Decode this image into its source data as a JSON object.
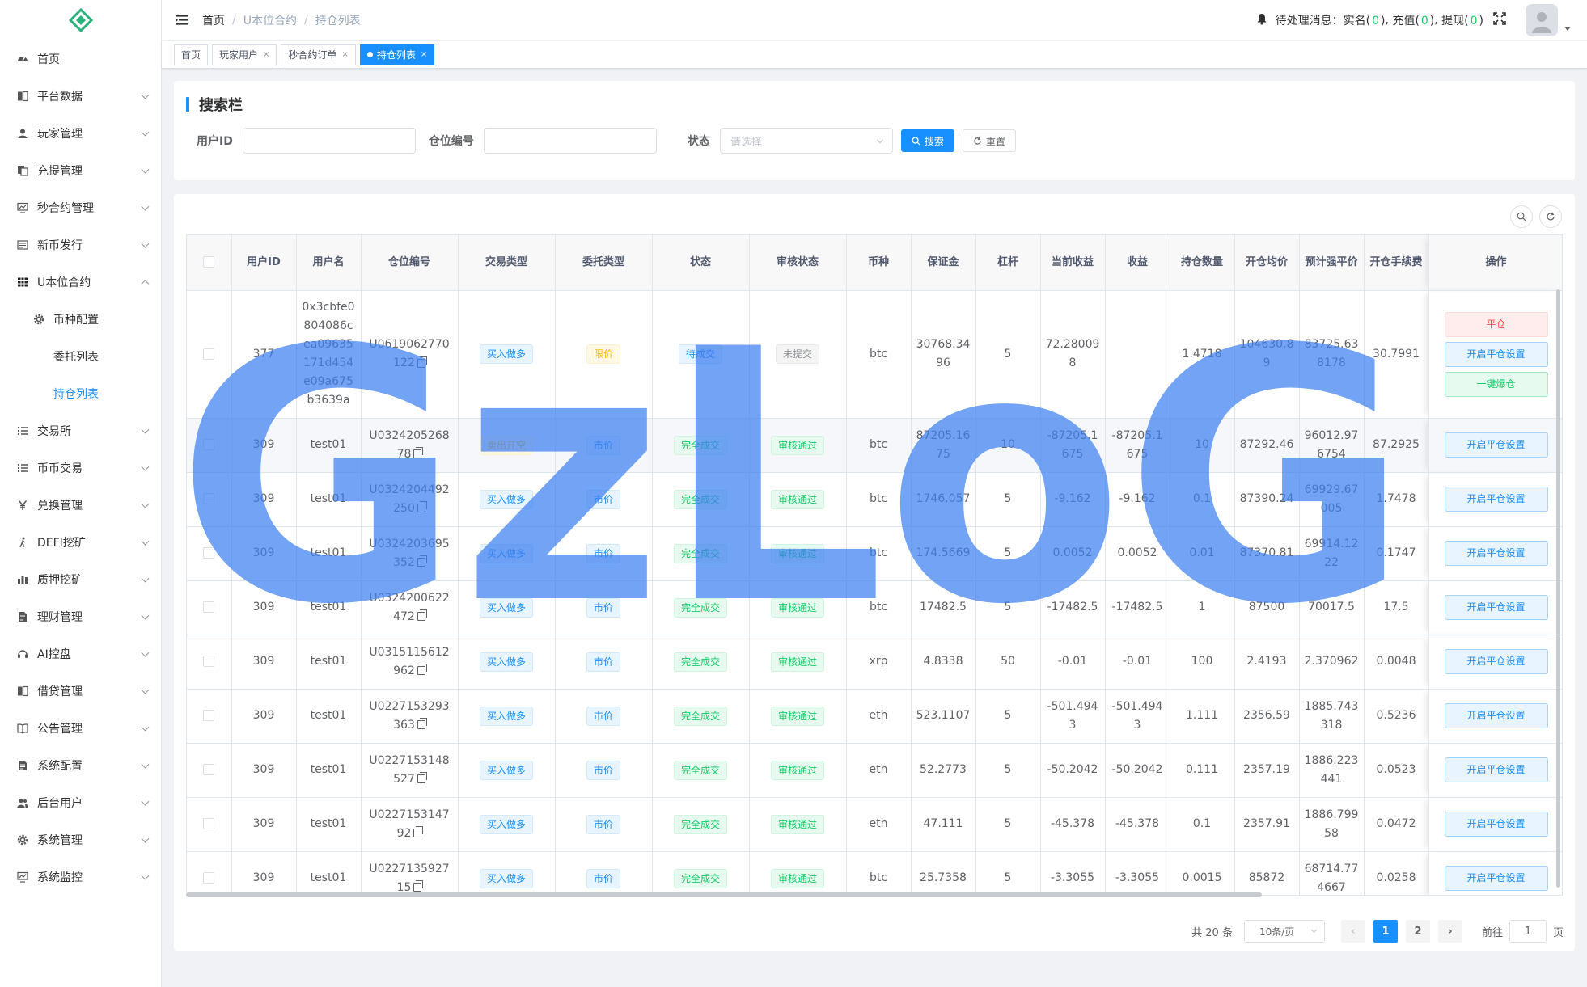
{
  "sidebar": {
    "items": [
      {
        "label": "首页",
        "icon": "dashboard-icon",
        "has_arrow": false
      },
      {
        "label": "平台数据",
        "icon": "book-icon",
        "has_arrow": true
      },
      {
        "label": "玩家管理",
        "icon": "user-icon",
        "has_arrow": true
      },
      {
        "label": "充提管理",
        "icon": "documents-icon",
        "has_arrow": true
      },
      {
        "label": "秒合约管理",
        "icon": "monitor-chart-icon",
        "has_arrow": true
      },
      {
        "label": "新币发行",
        "icon": "form-icon",
        "has_arrow": true
      },
      {
        "label": "U本位合约",
        "icon": "table-grid-icon",
        "has_arrow": true,
        "expanded": true
      },
      {
        "label": "币种配置",
        "icon": "gear-icon",
        "sub": true
      },
      {
        "label": "委托列表",
        "sub2": true
      },
      {
        "label": "持仓列表",
        "sub2": true,
        "active": true
      },
      {
        "label": "交易所",
        "icon": "list-icon",
        "has_arrow": true
      },
      {
        "label": "币币交易",
        "icon": "list-icon",
        "has_arrow": true
      },
      {
        "label": "兑换管理",
        "icon": "yen-icon",
        "has_arrow": true
      },
      {
        "label": "DEFI挖矿",
        "icon": "walk-icon",
        "has_arrow": true
      },
      {
        "label": "质押挖矿",
        "icon": "bar-chart-icon",
        "has_arrow": true
      },
      {
        "label": "理财管理",
        "icon": "note-icon",
        "has_arrow": true
      },
      {
        "label": "AI控盘",
        "icon": "headset-icon",
        "has_arrow": true
      },
      {
        "label": "借贷管理",
        "icon": "book-icon",
        "has_arrow": true
      },
      {
        "label": "公告管理",
        "icon": "open-book-icon",
        "has_arrow": true
      },
      {
        "label": "系统配置",
        "icon": "note-icon",
        "has_arrow": true
      },
      {
        "label": "后台用户",
        "icon": "users-icon",
        "has_arrow": true
      },
      {
        "label": "系统管理",
        "icon": "gear-icon",
        "has_arrow": true
      },
      {
        "label": "系统监控",
        "icon": "monitor-chart-icon",
        "has_arrow": true
      }
    ]
  },
  "header": {
    "breadcrumb": [
      "首页",
      "U本位合约",
      "持仓列表"
    ],
    "notice_prefix": "待处理消息：",
    "notice_items": [
      {
        "label": "实名",
        "count": "0"
      },
      {
        "label": "充值",
        "count": "0"
      },
      {
        "label": "提现",
        "count": "0"
      }
    ]
  },
  "tags": [
    {
      "label": "首页",
      "closable": false,
      "active": false
    },
    {
      "label": "玩家用户",
      "closable": true,
      "active": false
    },
    {
      "label": "秒合约订单",
      "closable": true,
      "active": false
    },
    {
      "label": "持仓列表",
      "closable": true,
      "active": true
    }
  ],
  "search": {
    "title": "搜索栏",
    "user_id_label": "用户ID",
    "position_no_label": "仓位编号",
    "status_label": "状态",
    "status_placeholder": "请选择",
    "search_btn": "搜索",
    "reset_btn": "重置"
  },
  "table": {
    "columns": [
      "用户ID",
      "用户名",
      "仓位编号",
      "交易类型",
      "委托类型",
      "状态",
      "审核状态",
      "币种",
      "保证金",
      "杠杆",
      "当前收益",
      "收益",
      "持仓数量",
      "开仓均价",
      "预计强平价",
      "开仓手续费",
      "操作"
    ],
    "rows": [
      {
        "user_id": "377",
        "username": "0x3cbfe0804086cea09635171d454e09a675b3639a",
        "position_no": "U0619062770122",
        "trade_type": "买入做多",
        "trade_color": "blue",
        "order_type": "限价",
        "order_color": "yellow",
        "status": "待成交",
        "status_color": "blue",
        "audit": "未提交",
        "audit_color": "gray",
        "coin": "btc",
        "margin": "30768.3496",
        "leverage": "5",
        "current_profit": "72.280098",
        "profit": "",
        "qty": "1.4718",
        "open_price": "104630.89",
        "liq_price": "83725.638178",
        "open_fee": "30.7991",
        "actions": [
          "平仓",
          "开启平仓设置",
          "一键爆仓"
        ],
        "tall": true
      },
      {
        "user_id": "309",
        "username": "test01",
        "position_no": "U032420526878",
        "trade_type": "卖出开空",
        "trade_color": "yellow",
        "order_type": "市价",
        "order_color": "blue",
        "status": "完全成交",
        "status_color": "green",
        "audit": "审核通过",
        "audit_color": "green",
        "coin": "btc",
        "margin": "87205.1675",
        "leverage": "10",
        "current_profit": "-87205.1675",
        "profit": "-87205.1675",
        "qty": "10",
        "open_price": "87292.46",
        "liq_price": "96012.976754",
        "open_fee": "87.2925",
        "actions": [
          "开启平仓设置"
        ],
        "hl": true
      },
      {
        "user_id": "309",
        "username": "test01",
        "position_no": "U0324204492250",
        "trade_type": "买入做多",
        "trade_color": "blue",
        "order_type": "市价",
        "order_color": "blue",
        "status": "完全成交",
        "status_color": "green",
        "audit": "审核通过",
        "audit_color": "green",
        "coin": "btc",
        "margin": "1746.057",
        "leverage": "5",
        "current_profit": "-9.162",
        "profit": "-9.162",
        "qty": "0.1",
        "open_price": "87390.24",
        "liq_price": "69929.67005",
        "open_fee": "1.7478",
        "actions": [
          "开启平仓设置"
        ]
      },
      {
        "user_id": "309",
        "username": "test01",
        "position_no": "U0324203695352",
        "trade_type": "买入做多",
        "trade_color": "blue",
        "order_type": "市价",
        "order_color": "blue",
        "status": "完全成交",
        "status_color": "green",
        "audit": "审核通过",
        "audit_color": "green",
        "coin": "btc",
        "margin": "174.5669",
        "leverage": "5",
        "current_profit": "0.0052",
        "profit": "0.0052",
        "qty": "0.01",
        "open_price": "87370.81",
        "liq_price": "69914.1222",
        "open_fee": "0.1747",
        "actions": [
          "开启平仓设置"
        ]
      },
      {
        "user_id": "309",
        "username": "test01",
        "position_no": "U0324200622472",
        "trade_type": "买入做多",
        "trade_color": "blue",
        "order_type": "市价",
        "order_color": "blue",
        "status": "完全成交",
        "status_color": "green",
        "audit": "审核通过",
        "audit_color": "green",
        "coin": "btc",
        "margin": "17482.5",
        "leverage": "5",
        "current_profit": "-17482.5",
        "profit": "-17482.5",
        "qty": "1",
        "open_price": "87500",
        "liq_price": "70017.5",
        "open_fee": "17.5",
        "actions": [
          "开启平仓设置"
        ]
      },
      {
        "user_id": "309",
        "username": "test01",
        "position_no": "U0315115612962",
        "trade_type": "买入做多",
        "trade_color": "blue",
        "order_type": "市价",
        "order_color": "blue",
        "status": "完全成交",
        "status_color": "green",
        "audit": "审核通过",
        "audit_color": "green",
        "coin": "xrp",
        "margin": "4.8338",
        "leverage": "50",
        "current_profit": "-0.01",
        "profit": "-0.01",
        "qty": "100",
        "open_price": "2.4193",
        "liq_price": "2.370962",
        "open_fee": "0.0048",
        "actions": [
          "开启平仓设置"
        ]
      },
      {
        "user_id": "309",
        "username": "test01",
        "position_no": "U0227153293363",
        "trade_type": "买入做多",
        "trade_color": "blue",
        "order_type": "市价",
        "order_color": "blue",
        "status": "完全成交",
        "status_color": "green",
        "audit": "审核通过",
        "audit_color": "green",
        "coin": "eth",
        "margin": "523.1107",
        "leverage": "5",
        "current_profit": "-501.4943",
        "profit": "-501.4943",
        "qty": "1.111",
        "open_price": "2356.59",
        "liq_price": "1885.743318",
        "open_fee": "0.5236",
        "actions": [
          "开启平仓设置"
        ]
      },
      {
        "user_id": "309",
        "username": "test01",
        "position_no": "U0227153148527",
        "trade_type": "买入做多",
        "trade_color": "blue",
        "order_type": "市价",
        "order_color": "blue",
        "status": "完全成交",
        "status_color": "green",
        "audit": "审核通过",
        "audit_color": "green",
        "coin": "eth",
        "margin": "52.2773",
        "leverage": "5",
        "current_profit": "-50.2042",
        "profit": "-50.2042",
        "qty": "0.111",
        "open_price": "2357.19",
        "liq_price": "1886.223441",
        "open_fee": "0.0523",
        "actions": [
          "开启平仓设置"
        ]
      },
      {
        "user_id": "309",
        "username": "test01",
        "position_no": "U022715314792",
        "trade_type": "买入做多",
        "trade_color": "blue",
        "order_type": "市价",
        "order_color": "blue",
        "status": "完全成交",
        "status_color": "green",
        "audit": "审核通过",
        "audit_color": "green",
        "coin": "eth",
        "margin": "47.111",
        "leverage": "5",
        "current_profit": "-45.378",
        "profit": "-45.378",
        "qty": "0.1",
        "open_price": "2357.91",
        "liq_price": "1886.79958",
        "open_fee": "0.0472",
        "actions": [
          "开启平仓设置"
        ]
      },
      {
        "user_id": "309",
        "username": "test01",
        "position_no": "U022713592715",
        "trade_type": "买入做多",
        "trade_color": "blue",
        "order_type": "市价",
        "order_color": "blue",
        "status": "完全成交",
        "status_color": "green",
        "audit": "审核通过",
        "audit_color": "green",
        "coin": "btc",
        "margin": "25.7358",
        "leverage": "5",
        "current_profit": "-3.3055",
        "profit": "-3.3055",
        "qty": "0.0015",
        "open_price": "85872",
        "liq_price": "68714.774667",
        "open_fee": "0.0258",
        "actions": [
          "开启平仓设置"
        ]
      }
    ]
  },
  "pagination": {
    "total": "共 20 条",
    "page_size": "10条/页",
    "pages": [
      "1",
      "2"
    ],
    "current": "1",
    "goto_prefix": "前往",
    "goto_value": "1",
    "goto_suffix": "页"
  },
  "watermark": {
    "text": "GzLoG",
    "color": "#3d7ff0"
  },
  "colors": {
    "primary": "#1890ff",
    "success": "#13ce66",
    "warning": "#ffba00",
    "danger": "#ff4949"
  }
}
